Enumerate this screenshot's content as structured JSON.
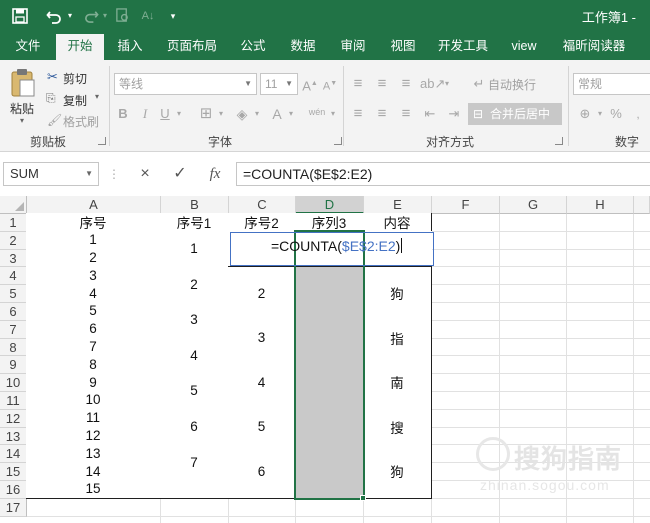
{
  "titlebar": {
    "save_icon": "floppy-save-icon",
    "undo_icon": "undo-icon",
    "redo_icon": "redo-icon",
    "preview_icon": "print-preview-icon",
    "sort_icon": "sort-az-icon",
    "customize_icon": "customize-arrow-icon",
    "doc_title": "工作簿1 -"
  },
  "tabs": [
    "文件",
    "开始",
    "插入",
    "页面布局",
    "公式",
    "数据",
    "审阅",
    "视图",
    "开发工具",
    "view",
    "福昕阅读器"
  ],
  "active_tab": "开始",
  "ribbon": {
    "clipboard": {
      "label": "剪贴板",
      "paste": "粘贴",
      "cut": "剪切",
      "copy": "复制",
      "format_painter": "格式刷"
    },
    "font": {
      "label": "字体",
      "font_name": "等线",
      "font_size": "11",
      "grow": "A",
      "shrink": "A",
      "bold": "B",
      "italic": "I",
      "underline": "U",
      "wen": "wén"
    },
    "alignment": {
      "label": "对齐方式",
      "wrap_text": "自动换行",
      "merge_center": "合并后居中"
    },
    "number": {
      "label": "数字",
      "format": "常规",
      "percent": "%"
    }
  },
  "formula_bar": {
    "name_box": "SUM",
    "cancel": "×",
    "enter": "✓",
    "fx": "fx",
    "formula": "=COUNTA($E$2:E2)"
  },
  "columns": [
    "A",
    "B",
    "C",
    "D",
    "E",
    "F",
    "G",
    "H"
  ],
  "rows": [
    "1",
    "2",
    "3",
    "4",
    "5",
    "6",
    "7",
    "8",
    "9",
    "10",
    "11",
    "12",
    "13",
    "14",
    "15",
    "16",
    "17"
  ],
  "headers": {
    "A": "序号",
    "B": "序号1",
    "C": "序号2",
    "D": "序列3",
    "E": "内容"
  },
  "col_a": [
    "1",
    "2",
    "3",
    "4",
    "5",
    "6",
    "7",
    "8",
    "9",
    "10",
    "11",
    "12",
    "13",
    "14",
    "15"
  ],
  "col_b": [
    "1",
    "2",
    "3",
    "4",
    "5",
    "6",
    "7"
  ],
  "col_c": [
    "2",
    "3",
    "4",
    "5",
    "6"
  ],
  "col_e": [
    "狗",
    "指",
    "南",
    "搜",
    "狗"
  ],
  "editing": {
    "prefix": "=COUNTA(",
    "ref": "$E$2:E2",
    "suffix": ")"
  },
  "watermark": {
    "text": "搜狗指南",
    "url": "zhinan.sogou.com"
  }
}
